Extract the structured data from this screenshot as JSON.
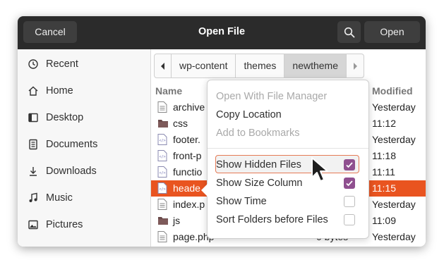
{
  "header": {
    "title": "Open File",
    "cancel_label": "Cancel",
    "open_label": "Open"
  },
  "sidebar": {
    "items": [
      {
        "label": "Recent",
        "icon": "clock-icon"
      },
      {
        "label": "Home",
        "icon": "home-icon"
      },
      {
        "label": "Desktop",
        "icon": "desktop-icon"
      },
      {
        "label": "Documents",
        "icon": "document-icon"
      },
      {
        "label": "Downloads",
        "icon": "download-icon"
      },
      {
        "label": "Music",
        "icon": "music-icon"
      },
      {
        "label": "Pictures",
        "icon": "picture-icon"
      }
    ]
  },
  "pathbar": {
    "segments": [
      "wp-content",
      "themes",
      "newtheme"
    ],
    "active": "newtheme"
  },
  "filelist": {
    "columns": {
      "name": "Name",
      "modified": "Modified"
    },
    "rows": [
      {
        "name": "archive",
        "size": "",
        "modified": "Yesterday",
        "icon": "text-file-icon",
        "selected": false
      },
      {
        "name": "css",
        "size": "",
        "modified": "11:12",
        "icon": "folder-icon",
        "selected": false
      },
      {
        "name": "footer.",
        "size": "",
        "modified": "Yesterday",
        "icon": "php-file-icon",
        "selected": false
      },
      {
        "name": "front-p",
        "size": "",
        "modified": "11:18",
        "icon": "php-file-icon",
        "selected": false
      },
      {
        "name": "functio",
        "size": "",
        "modified": "11:11",
        "icon": "php-file-icon",
        "selected": false
      },
      {
        "name": "heade",
        "size": "",
        "modified": "11:15",
        "icon": "php-file-icon",
        "selected": true
      },
      {
        "name": "index.p",
        "size": "",
        "modified": "Yesterday",
        "icon": "text-file-icon",
        "selected": false
      },
      {
        "name": "js",
        "size": "",
        "modified": "11:09",
        "icon": "folder-icon",
        "selected": false
      },
      {
        "name": "page.php",
        "size": "0 bytes",
        "modified": "Yesterday",
        "icon": "text-file-icon",
        "selected": false
      }
    ]
  },
  "context_menu": {
    "items": [
      {
        "label": "Open With File Manager",
        "enabled": false
      },
      {
        "label": "Copy Location",
        "enabled": true
      },
      {
        "label": "Add to Bookmarks",
        "enabled": false
      },
      {
        "label": "Show Hidden Files",
        "enabled": true,
        "checked": true,
        "hovered": true
      },
      {
        "label": "Show Size Column",
        "enabled": true,
        "checked": true
      },
      {
        "label": "Show Time",
        "enabled": true,
        "checked": false
      },
      {
        "label": "Sort Folders before Files",
        "enabled": true,
        "checked": false
      }
    ]
  },
  "colors": {
    "accent": "#e95420",
    "checkbox_on": "#8f4f8f",
    "header_bg": "#2b2b2b"
  }
}
